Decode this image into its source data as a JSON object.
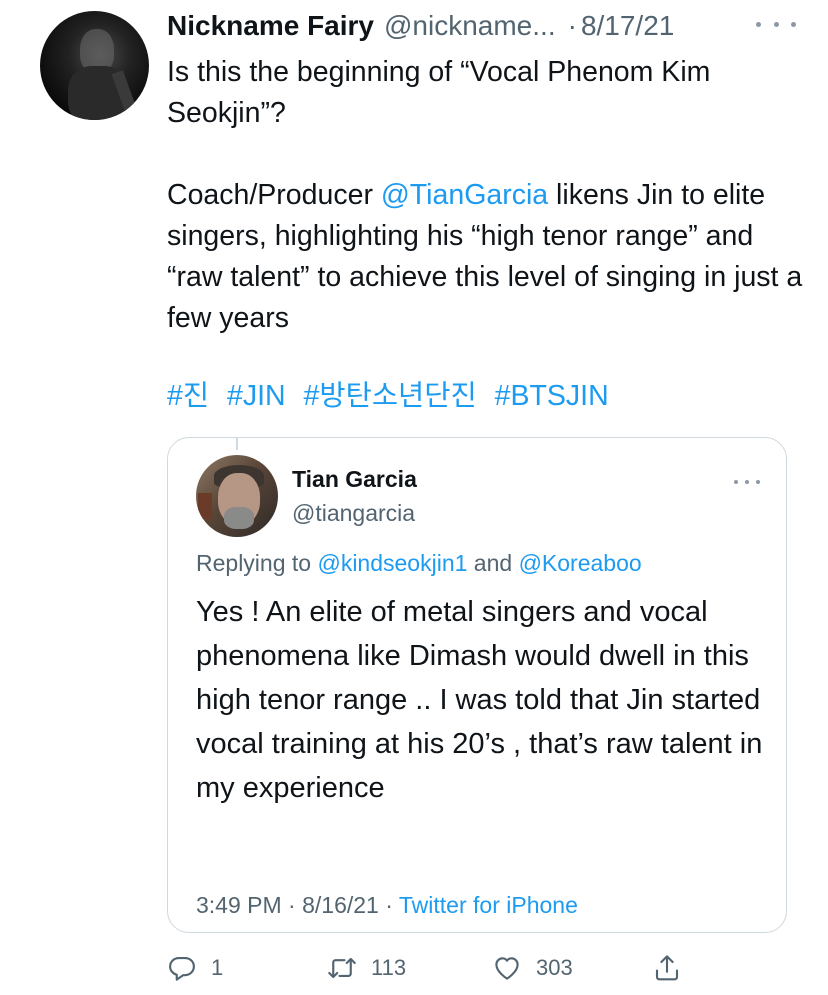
{
  "author": {
    "name": "Nickname Fairy",
    "handle": "@nickname...",
    "separator": "·",
    "date": "8/17/21",
    "avatar_icon": "user-avatar"
  },
  "tweet": {
    "line1": "Is this the beginning of “Vocal Phenom Kim Seokjin”?",
    "p2_before": "Coach/Producer ",
    "p2_mention": "@TianGarcia",
    "p2_after": " likens Jin to elite singers, highlighting his “high tenor range” and “raw talent” to achieve this level of singing in just a few years",
    "hashtags": [
      "#진",
      "#JIN",
      "#방탄소년단진",
      "#BTSJIN"
    ]
  },
  "quote": {
    "name": "Tian Garcia",
    "handle": "@tiangarcia",
    "replying_prefix": "Replying to ",
    "replying_mention1": "@kindseokjin1",
    "replying_and": " and ",
    "replying_mention2": "@Koreaboo",
    "text": "Yes ! An elite of metal singers and vocal phenomena like Dimash would dwell in this high tenor range .. I was told that Jin started vocal training at his 20’s , that’s raw talent in my experience",
    "time": "3:49 PM",
    "meta_sep1": " · ",
    "date": "8/16/21",
    "meta_sep2": " · ",
    "source": "Twitter for iPhone"
  },
  "actions": {
    "replies": "1",
    "retweets": "113",
    "likes": "303"
  },
  "colors": {
    "link": "#1d9bf0",
    "secondary": "#536471",
    "border": "#cfd9de"
  }
}
